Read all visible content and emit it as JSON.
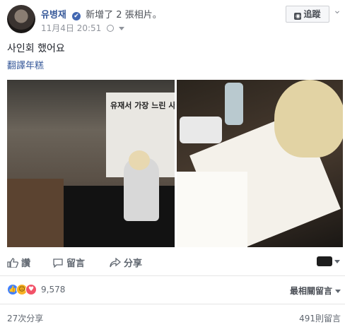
{
  "header": {
    "author_name": "유병재",
    "verified_mark": "✔",
    "action_text": "新增了 2 張相片。",
    "timestamp": "11月4日 20:51",
    "follow_label": "追蹤",
    "more_icon": "more-icon"
  },
  "post": {
    "text": "사인회 했어요",
    "translate_label": "翻譯年糕",
    "photos": [
      {
        "banner_text": "유재서 가장 느린 사인회"
      },
      {
        "subject": "signing-notebook"
      }
    ]
  },
  "actions": {
    "like_label": "讚",
    "comment_label": "留言",
    "share_label": "分享"
  },
  "footer": {
    "reaction_count": "9,578",
    "sort_label": "最相關留言",
    "shares_label": "27次分享",
    "comments_label": "491則留言"
  },
  "colors": {
    "link": "#365899",
    "muted": "#90949c",
    "like": "#4080ff",
    "love": "#f25268",
    "haha": "#f7b125"
  }
}
